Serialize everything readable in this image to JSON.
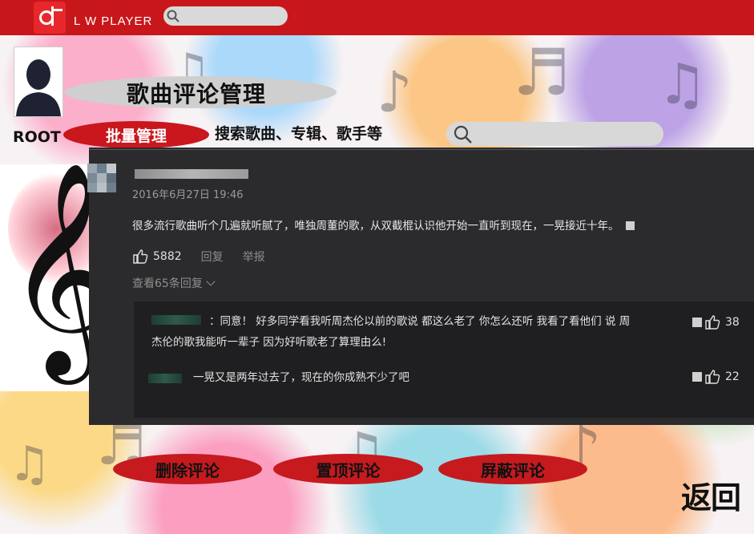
{
  "app": {
    "brand": "L W PLAYER"
  },
  "header": {
    "title": "歌曲评论管理",
    "user_label": "ROOT",
    "batch_button": "批量管理",
    "search_label": "搜索歌曲、专辑、歌手等"
  },
  "comment": {
    "date": "2016年6月27日 19:46",
    "text": "很多流行歌曲听个几遍就听腻了，唯独周董的歌，从双截棍认识他开始一直听到现在，一晃接近十年。",
    "likes": "5882",
    "reply_label": "回复",
    "report_label": "举报",
    "view_replies": "查看65条回复"
  },
  "replies": [
    {
      "line1": "：同意！ 好多同学看我听周杰伦以前的歌说 都这么老了 你怎么还听 我看了看他们 说 周",
      "line2": "杰伦的歌我能听一辈子 因为好听歌老了算理由么!",
      "likes": "38"
    },
    {
      "line1": "一晃又是两年过去了，现在的你成熟不少了吧",
      "likes": "22"
    }
  ],
  "actions": {
    "delete": "删除评论",
    "pin": "置顶评论",
    "block": "屏蔽评论",
    "back": "返回"
  },
  "colors": {
    "brand_red": "#c8171b",
    "button_red": "#c61a1f",
    "panel": "#2b2b2d"
  }
}
